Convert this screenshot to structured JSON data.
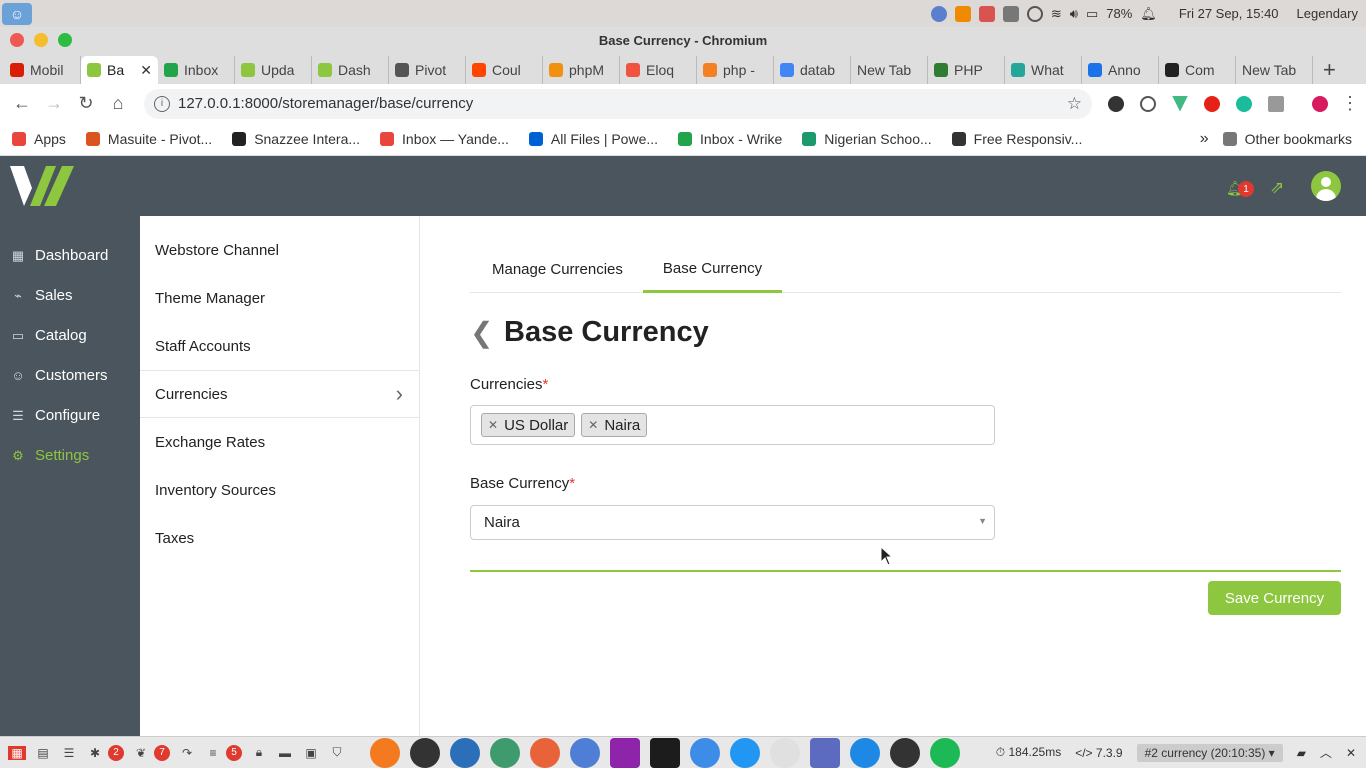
{
  "os": {
    "battery": "78%",
    "datetime": "Fri 27 Sep, 15:40",
    "user": "Legendary"
  },
  "window": {
    "title": "Base Currency - Chromium"
  },
  "tabs": [
    {
      "label": "Mobil",
      "color": "#d81e05"
    },
    {
      "label": "Ba",
      "color": "#8dc63f",
      "active": true
    },
    {
      "label": "Inbox",
      "color": "#22a44a"
    },
    {
      "label": "Upda",
      "color": "#8dc63f"
    },
    {
      "label": "Dash",
      "color": "#8dc63f"
    },
    {
      "label": "Pivot",
      "color": "#555555"
    },
    {
      "label": "Coul",
      "color": "#ff4500"
    },
    {
      "label": "phpM",
      "color": "#f29111"
    },
    {
      "label": "Eloq",
      "color": "#f05340"
    },
    {
      "label": "php -",
      "color": "#f48024"
    },
    {
      "label": "datab",
      "color": "#4285f4"
    },
    {
      "label": "New Tab",
      "color": ""
    },
    {
      "label": "PHP",
      "color": "#2e7d32"
    },
    {
      "label": "What",
      "color": "#26a69a"
    },
    {
      "label": "Anno",
      "color": "#1a73e8"
    },
    {
      "label": "Com",
      "color": "#222222"
    },
    {
      "label": "New Tab",
      "color": ""
    }
  ],
  "address": {
    "url": "127.0.0.1:8000/storemanager/base/currency"
  },
  "bookmarks": [
    {
      "label": "Apps",
      "color": "#e8453c"
    },
    {
      "label": "Masuite - Pivot...",
      "color": "#d9541e"
    },
    {
      "label": "Snazzee Intera...",
      "color": "#222222"
    },
    {
      "label": "Inbox — Yande...",
      "color": "#e8453c"
    },
    {
      "label": "All Files | Powe...",
      "color": "#0061d5"
    },
    {
      "label": "Inbox - Wrike",
      "color": "#22a44a"
    },
    {
      "label": "Nigerian Schoo...",
      "color": "#1d9a6c"
    },
    {
      "label": "Free Responsiv...",
      "color": "#333333"
    }
  ],
  "bookmarks_other": "Other bookmarks",
  "header": {
    "notification_count": "1"
  },
  "leftnav": [
    {
      "label": "Dashboard",
      "icon": "dashboard-icon",
      "glyph": "▦"
    },
    {
      "label": "Sales",
      "icon": "sales-chart-icon",
      "glyph": "⌁"
    },
    {
      "label": "Catalog",
      "icon": "catalog-icon",
      "glyph": "▭"
    },
    {
      "label": "Customers",
      "icon": "customers-icon",
      "glyph": "☺"
    },
    {
      "label": "Configure",
      "icon": "configure-sliders-icon",
      "glyph": "☰"
    },
    {
      "label": "Settings",
      "icon": "settings-gear-icon",
      "glyph": "⚙",
      "active": true
    }
  ],
  "submenu": [
    {
      "label": "Webstore Channel"
    },
    {
      "label": "Theme Manager"
    },
    {
      "label": "Staff Accounts"
    },
    {
      "label": "Currencies",
      "active": true
    },
    {
      "label": "Exchange Rates"
    },
    {
      "label": "Inventory Sources"
    },
    {
      "label": "Taxes"
    }
  ],
  "page": {
    "tabs": [
      {
        "label": "Manage Currencies"
      },
      {
        "label": "Base Currency",
        "active": true
      }
    ],
    "title": "Base Currency",
    "currencies_label": "Currencies",
    "currencies": [
      "US Dollar",
      "Naira"
    ],
    "base_label": "Base Currency",
    "base_value": "Naira",
    "required_mark": "*",
    "save_label": "Save Currency"
  },
  "taskbar": {
    "badge_bugs": "2",
    "badge_views": "7",
    "badge_db": "5",
    "timing": "184.25ms",
    "php_version": "7.3.9",
    "route": "#2 currency (20:10:35)"
  },
  "colors": {
    "brand_green": "#8dc63f",
    "header_bg": "#4a555d",
    "required": "#e0392e"
  }
}
